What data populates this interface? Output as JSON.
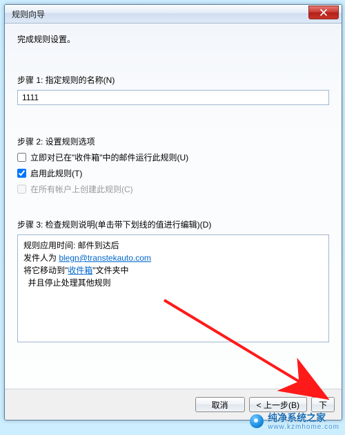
{
  "window": {
    "title": "规则向导"
  },
  "header_text": "完成规则设置。",
  "step1": {
    "label": "步骤 1: 指定规则的名称(N)",
    "value": "1111"
  },
  "step2": {
    "label": "步骤 2: 设置规则选项",
    "opt_run_now": {
      "label": "立即对已在\"收件箱\"中的邮件运行此规则(U)",
      "checked": false
    },
    "opt_enable": {
      "label": "启用此规则(T)",
      "checked": true
    },
    "opt_all_accounts": {
      "label": "在所有帐户上创建此规则(C)",
      "checked": false,
      "disabled": true
    }
  },
  "step3": {
    "label": "步骤 3: 检查规则说明(单击带下划线的值进行编辑)(D)",
    "line1": "规则应用时间: 邮件到达后",
    "line2_prefix": "发件人为 ",
    "line2_link": "blegn@transtekauto.com",
    "line3_prefix": "将它移动到\"",
    "line3_link": "收件箱",
    "line3_suffix": "\"文件夹中",
    "line4": "  并且停止处理其他规则"
  },
  "footer": {
    "cancel": "取消",
    "back": "< 上一步(B)",
    "next": "下"
  },
  "watermark": {
    "text": "纯净系统之家",
    "sub": "www.kzmhome.com"
  }
}
